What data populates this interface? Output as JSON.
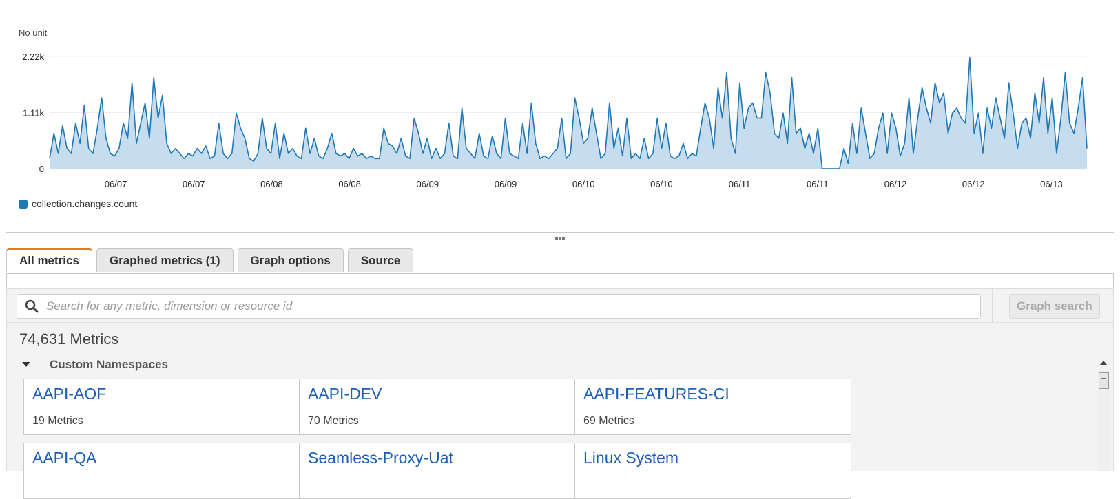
{
  "chart_data": {
    "type": "area",
    "unit_label": "No unit",
    "yticks": [
      "0",
      "1.11k",
      "2.22k"
    ],
    "ylim": [
      0,
      2220
    ],
    "x_tick_labels": [
      "06/07",
      "06/07",
      "06/08",
      "06/08",
      "06/09",
      "06/09",
      "06/10",
      "06/10",
      "06/11",
      "06/11",
      "06/12",
      "06/12",
      "06/13"
    ],
    "grid": "horizontal",
    "legend_position": "bottom-left",
    "series": [
      {
        "name": "collection.changes.count",
        "color": "#1f77b4",
        "values": [
          200,
          700,
          300,
          850,
          400,
          300,
          900,
          500,
          1250,
          400,
          300,
          800,
          1400,
          600,
          300,
          250,
          400,
          900,
          600,
          1700,
          500,
          900,
          1300,
          600,
          1800,
          1000,
          1450,
          500,
          300,
          400,
          300,
          200,
          300,
          250,
          400,
          300,
          450,
          200,
          250,
          900,
          300,
          200,
          300,
          1100,
          800,
          600,
          200,
          150,
          300,
          1000,
          400,
          300,
          900,
          200,
          700,
          300,
          400,
          250,
          200,
          800,
          300,
          600,
          250,
          200,
          400,
          700,
          300,
          250,
          300,
          200,
          400,
          250,
          300,
          200,
          250,
          200,
          200,
          800,
          500,
          450,
          300,
          600,
          250,
          200,
          1000,
          700,
          300,
          600,
          200,
          400,
          200,
          300,
          900,
          250,
          200,
          1200,
          400,
          300,
          200,
          700,
          250,
          200,
          650,
          300,
          200,
          1000,
          300,
          250,
          200,
          900,
          300,
          1300,
          500,
          200,
          250,
          200,
          300,
          400,
          1000,
          200,
          300,
          1400,
          1000,
          500,
          600,
          1200,
          700,
          200,
          300,
          1300,
          400,
          800,
          250,
          1000,
          200,
          300,
          200,
          600,
          200,
          300,
          1000,
          400,
          900,
          250,
          200,
          250,
          500,
          200,
          300,
          250,
          800,
          1300,
          1000,
          400,
          1600,
          1000,
          1900,
          600,
          300,
          1700,
          800,
          1200,
          1300,
          1000,
          1000,
          1900,
          1500,
          700,
          600,
          1100,
          500,
          1800,
          700,
          800,
          400,
          700,
          300,
          800,
          0,
          0,
          0,
          0,
          0,
          400,
          100,
          900,
          300,
          1200,
          700,
          200,
          300,
          800,
          1100,
          300,
          1100,
          800,
          250,
          500,
          1400,
          300,
          1000,
          1600,
          1200,
          900,
          1700,
          1300,
          1500,
          700,
          1100,
          1200,
          1000,
          900,
          2200,
          700,
          1100,
          300,
          1200,
          800,
          1400,
          1000,
          600,
          1700,
          1100,
          400,
          900,
          1000,
          600,
          1500,
          900,
          1800,
          700,
          1400,
          300,
          1000,
          1900,
          900,
          700,
          1200,
          1800,
          400
        ]
      }
    ]
  },
  "tabs": [
    {
      "label": "All metrics"
    },
    {
      "label": "Graphed metrics (1)"
    },
    {
      "label": "Graph options"
    },
    {
      "label": "Source"
    }
  ],
  "search": {
    "placeholder": "Search for any metric, dimension or resource id",
    "button_label": "Graph search",
    "icon": "search-icon"
  },
  "metrics_count": "74,631 Metrics",
  "namespace_section": {
    "title": "Custom Namespaces",
    "cards": [
      {
        "name": "AAPI-AOF",
        "count": "19 Metrics"
      },
      {
        "name": "AAPI-DEV",
        "count": "70 Metrics"
      },
      {
        "name": "AAPI-FEATURES-CI",
        "count": "69 Metrics"
      },
      {
        "name": "AAPI-QA",
        "count": ""
      },
      {
        "name": "Seamless-Proxy-Uat",
        "count": ""
      },
      {
        "name": "Linux System",
        "count": ""
      }
    ]
  }
}
